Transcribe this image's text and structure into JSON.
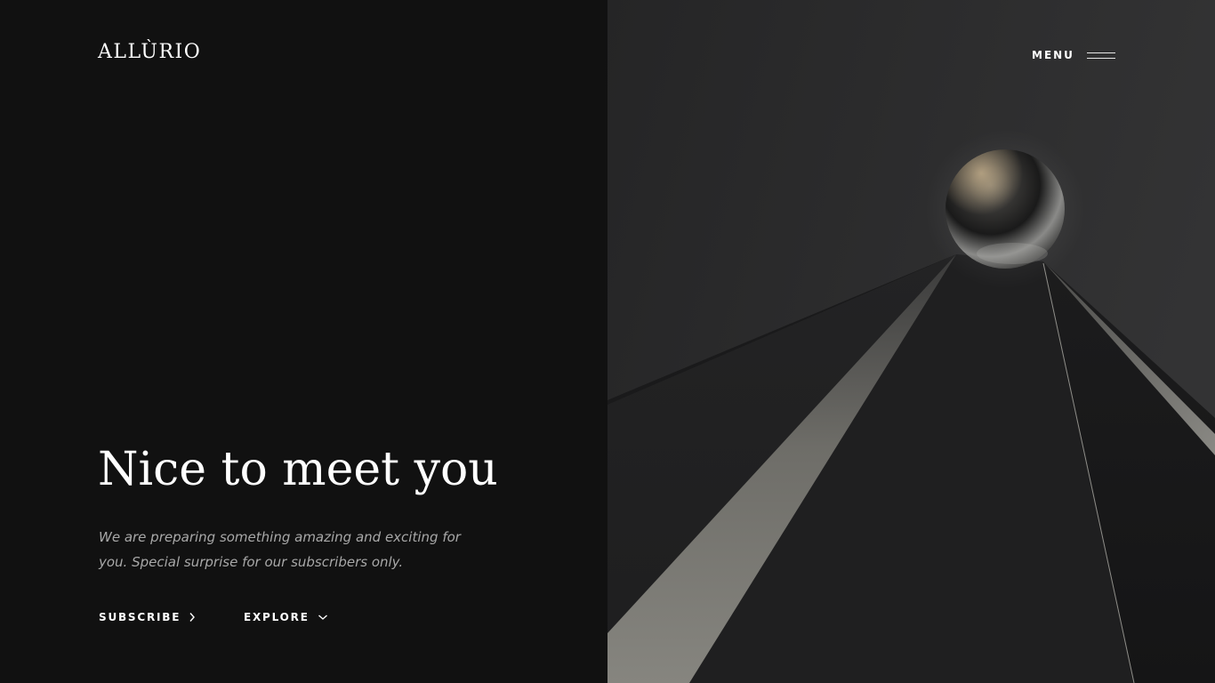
{
  "brand": {
    "logo": "ALLÙRIO"
  },
  "nav": {
    "menu_label": "MENU",
    "menu_icon": "hamburger-icon"
  },
  "hero": {
    "headline": "Nice to meet you",
    "tagline": "We are preparing something amazing and exciting for you. Special surprise for our subscribers only."
  },
  "actions": {
    "subscribe_label": "SUBSCRIBE",
    "subscribe_icon": "chevron-right-icon",
    "explore_label": "EXPLORE",
    "explore_icon": "chevron-down-icon"
  },
  "colors": {
    "left_background": "#111111",
    "right_background": "#2a2a2b",
    "text_primary": "#ffffff",
    "text_muted": "#a8a8a8"
  },
  "artwork": {
    "description_icon": "metal-sphere-artwork"
  }
}
